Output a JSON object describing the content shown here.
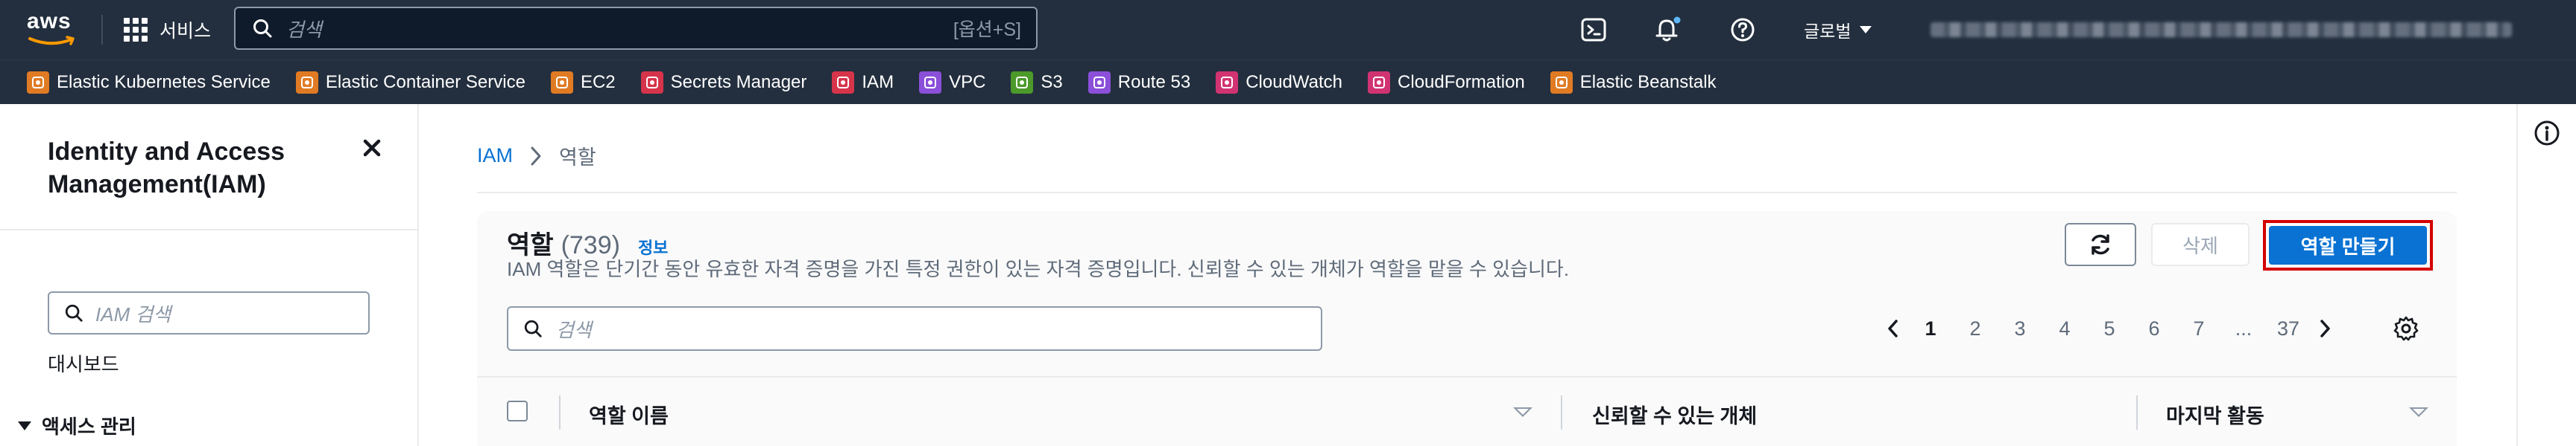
{
  "topnav": {
    "logo_text": "aws",
    "services_label": "서비스",
    "search_placeholder": "검색",
    "search_shortcut": "[옵션+S]",
    "region_label": "글로벌"
  },
  "favorites": [
    {
      "label": "Elastic Kubernetes Service",
      "color": "#e07b24"
    },
    {
      "label": "Elastic Container Service",
      "color": "#e07b24"
    },
    {
      "label": "EC2",
      "color": "#e07b24"
    },
    {
      "label": "Secrets Manager",
      "color": "#d6344b"
    },
    {
      "label": "IAM",
      "color": "#d6344b"
    },
    {
      "label": "VPC",
      "color": "#8b4fd9"
    },
    {
      "label": "S3",
      "color": "#4c9a2a"
    },
    {
      "label": "Route 53",
      "color": "#8b4fd9"
    },
    {
      "label": "CloudWatch",
      "color": "#d13372"
    },
    {
      "label": "CloudFormation",
      "color": "#d13372"
    },
    {
      "label": "Elastic Beanstalk",
      "color": "#e07b24"
    }
  ],
  "sidenav": {
    "title": "Identity and Access Management(IAM)",
    "search_placeholder": "IAM 검색",
    "dashboard": "대시보드",
    "section_access": "액세스 관리"
  },
  "breadcrumb": {
    "root": "IAM",
    "current": "역할"
  },
  "roles": {
    "title": "역할",
    "count": "(739)",
    "info_link": "정보",
    "description": "IAM 역할은 단기간 동안 유효한 자격 증명을 가진 특정 권한이 있는 자격 증명입니다. 신뢰할 수 있는 개체가 역할을 맡을 수 있습니다.",
    "delete_label": "삭제",
    "create_label": "역할 만들기",
    "filter_placeholder": "검색"
  },
  "pagination": {
    "pages": [
      "1",
      "2",
      "3",
      "4",
      "5",
      "6",
      "7",
      "...",
      "37"
    ],
    "active": "1"
  },
  "table": {
    "headers": [
      "역할 이름",
      "신뢰할 수 있는 개체",
      "마지막 활동"
    ]
  },
  "colors": {
    "nav_bg": "#232f3e",
    "primary": "#0972d3",
    "highlight_border": "#d40000"
  }
}
